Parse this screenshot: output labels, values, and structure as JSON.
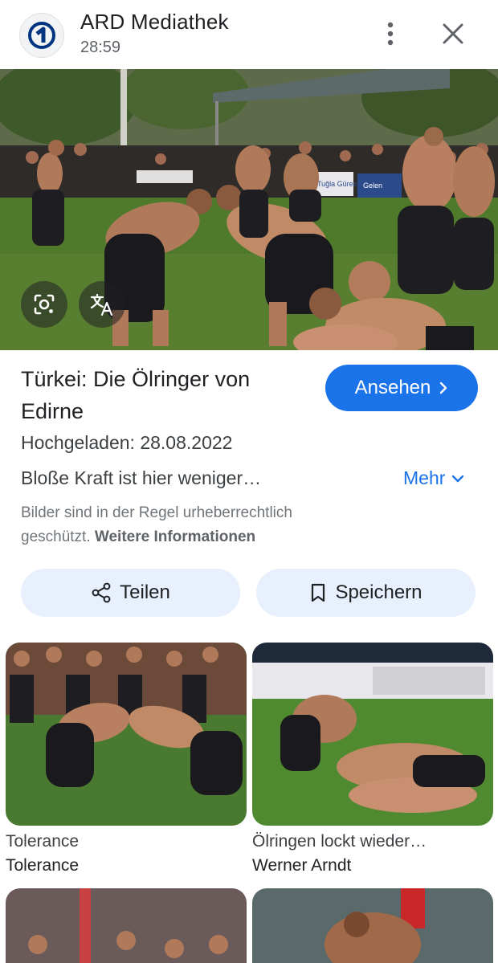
{
  "header": {
    "app_title": "ARD Mediathek",
    "duration": "28:59"
  },
  "video": {
    "title": "Türkei: Die Ölringer von Edirne",
    "watch_label": "Ansehen",
    "upload_date": "Hochgeladen: 28.08.2022",
    "description": "Bloße Kraft ist hier weniger…",
    "more_label": "Mehr",
    "copyright_text": "Bilder sind in der Regel urheberrechtlich geschützt.",
    "copyright_link": "Weitere Informationen",
    "banner_texts": [
      "Tuğla Gürespor",
      "Gelen"
    ]
  },
  "actions": {
    "share_label": "Teilen",
    "save_label": "Speichern"
  },
  "related": [
    {
      "title": "Tolerance",
      "source": "Tolerance"
    },
    {
      "title": "Ölringen lockt wieder…",
      "source": "Werner Arndt"
    },
    {
      "title": "",
      "source": ""
    },
    {
      "title": "",
      "source": ""
    }
  ],
  "colors": {
    "accent": "#1a73e8",
    "pill_bg": "#e8f0fe",
    "ard_logo": "#003480",
    "grass": "#4f7a2c"
  },
  "icons": [
    "ard-logo-icon",
    "more-vert-icon",
    "close-icon",
    "lens-icon",
    "translate-icon",
    "chevron-right-icon",
    "chevron-down-icon",
    "share-icon",
    "bookmark-icon"
  ]
}
